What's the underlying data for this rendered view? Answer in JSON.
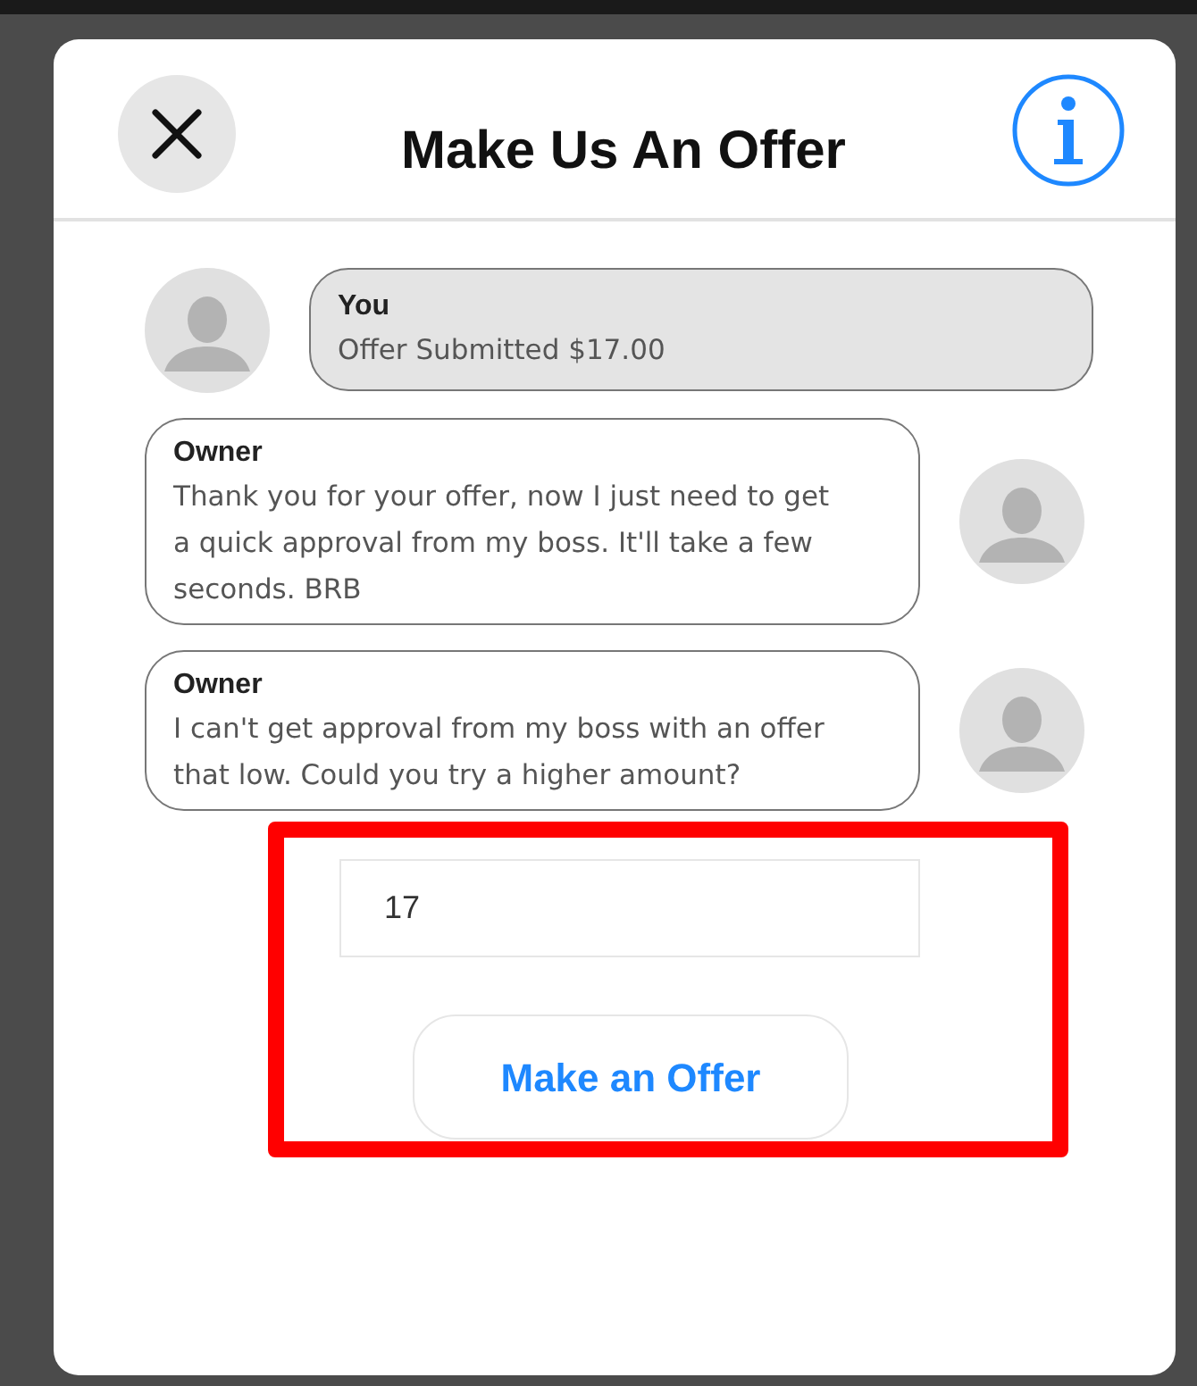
{
  "dialog": {
    "title": "Make Us An Offer"
  },
  "messages": [
    {
      "kind": "you",
      "sender": "You",
      "text": "Offer Submitted $17.00"
    },
    {
      "kind": "owner",
      "sender": "Owner",
      "text": "Thank you for your offer, now I just need to get a quick approval from my boss. It'll take a few seconds. BRB"
    },
    {
      "kind": "owner",
      "sender": "Owner",
      "text": "I can't get approval from my boss with an offer that low. Could you try a higher amount?"
    }
  ],
  "offer_field": {
    "value": "17"
  },
  "offer_button": {
    "label": "Make an Offer"
  },
  "highlight": true
}
